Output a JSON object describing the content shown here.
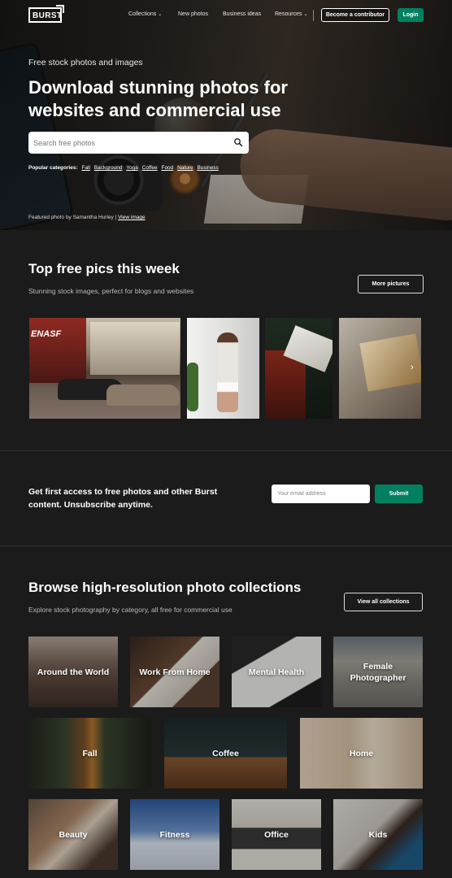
{
  "nav": {
    "logo": "BURST",
    "links": [
      {
        "label": "Collections",
        "caret": true
      },
      {
        "label": "New photos",
        "caret": false
      },
      {
        "label": "Business ideas",
        "caret": false
      },
      {
        "label": "Resources",
        "caret": true
      }
    ],
    "contributor_label": "Become a contributor",
    "login_label": "Login"
  },
  "hero": {
    "kicker": "Free stock photos and images",
    "title": "Download stunning photos for websites and commercial use",
    "search_placeholder": "Search free photos",
    "popular_label": "Popular categories:",
    "categories": [
      "Fall",
      "Background",
      "Yoga",
      "Coffee",
      "Food",
      "Nature",
      "Business"
    ],
    "featured_prefix": "Featured photo by Samantha Hurley |",
    "featured_link": "View image"
  },
  "top_pics": {
    "title": "Top free pics this week",
    "subtitle": "Stunning stock images, perfect for blogs and websites",
    "more_label": "More pictures",
    "street_sign": "ENASF"
  },
  "newsletter": {
    "text": "Get first access to free photos and other Burst content. Unsubscribe anytime.",
    "email_placeholder": "Your email address",
    "submit_label": "Submit"
  },
  "collections": {
    "title": "Browse high-resolution photo collections",
    "subtitle": "Explore stock photography by category, all free for commercial use",
    "view_all_label": "View all collections",
    "tiles": [
      "Around the World",
      "Work From Home",
      "Mental Health",
      "Female Photographer",
      "Fall",
      "Coffee",
      "Home",
      "Beauty",
      "Fitness",
      "Office",
      "Kids"
    ]
  },
  "colors": {
    "accent": "#008060",
    "background": "#1b1b1b"
  }
}
